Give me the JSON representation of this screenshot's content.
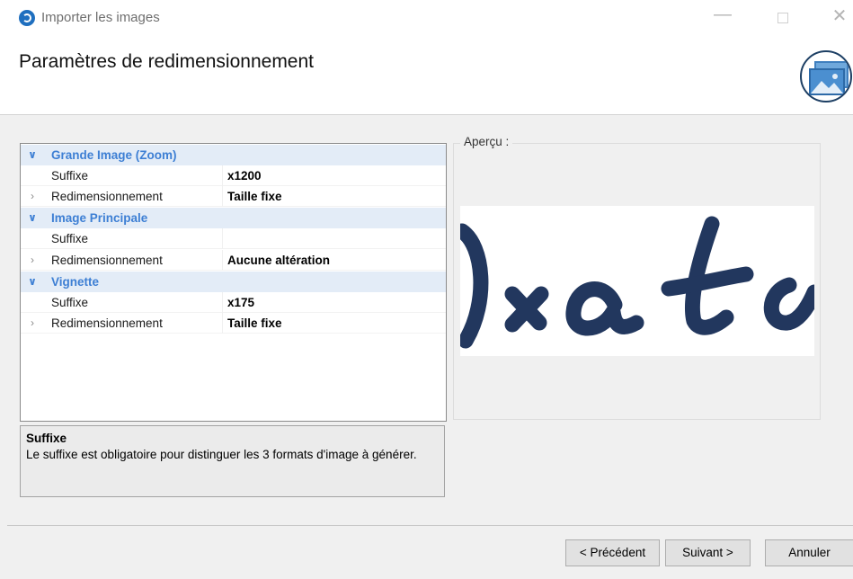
{
  "window": {
    "title": "Importer les images",
    "minimize_glyph": "—",
    "close_glyph": "✕"
  },
  "header": {
    "title": "Paramètres de redimensionnement",
    "icon": "image-gallery-icon"
  },
  "groups": [
    {
      "title": "Grande Image (Zoom)",
      "expanded": true,
      "properties": [
        {
          "name": "Suffixe",
          "value": "x1200"
        },
        {
          "name": "Redimensionnement",
          "value": "Taille fixe"
        }
      ]
    },
    {
      "title": "Image Principale",
      "expanded": true,
      "properties": [
        {
          "name": "Suffixe",
          "value": ""
        },
        {
          "name": "Redimensionnement",
          "value": "Aucune altération"
        }
      ]
    },
    {
      "title": "Vignette",
      "expanded": true,
      "properties": [
        {
          "name": "Suffixe",
          "value": "x175"
        },
        {
          "name": "Redimensionnement",
          "value": "Taille fixe"
        }
      ]
    }
  ],
  "help": {
    "title": "Suffixe",
    "text": "Le suffixe est obligatoire pour distinguer les 3 formats d'image à générer."
  },
  "preview": {
    "label": "Aperçu :",
    "ink_color": "#22375e"
  },
  "buttons": {
    "previous": "< Précédent",
    "next": "Suivant >",
    "cancel": "Annuler"
  },
  "glyphs": {
    "expanded": "∨",
    "collapsed": "›"
  }
}
